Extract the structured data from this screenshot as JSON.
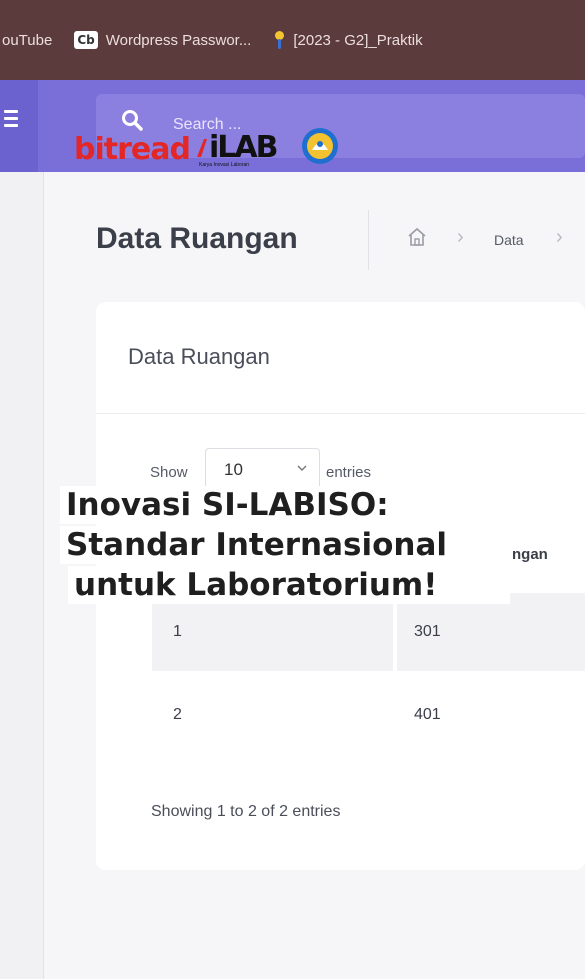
{
  "bookmarks": [
    {
      "label": "ouTube"
    },
    {
      "badge": "Cb",
      "label": "Wordpress Passwor..."
    },
    {
      "label": "[2023 - G2]_Praktik"
    }
  ],
  "header": {
    "search_placeholder": "Search ...",
    "accent": "#7a6fd8"
  },
  "logos": {
    "bitread": "bitread",
    "ilab": "iLAB",
    "ilab_tagline": "Karya Inovasi Laboran"
  },
  "page": {
    "title": "Data Ruangan",
    "breadcrumb": [
      "home",
      "Data"
    ]
  },
  "card": {
    "title": "Data Ruangan",
    "show_label": "Show",
    "show_value": "10",
    "entries_label": "entries",
    "column_partial": "ngan",
    "rows": [
      {
        "no": "1",
        "ruangan": "301"
      },
      {
        "no": "2",
        "ruangan": "401"
      }
    ],
    "info": "Showing 1 to 2 of 2 entries"
  },
  "caption": {
    "line1": "Inovasi SI-LABISO:",
    "line2": "Standar Internasional",
    "line3": "untuk Laboratorium!"
  }
}
